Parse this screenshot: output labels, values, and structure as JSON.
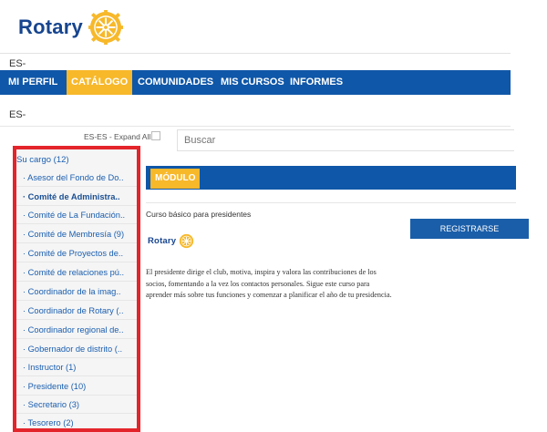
{
  "brand": {
    "name": "Rotary",
    "color": "#17458f",
    "wheel_color": "#f7b82a"
  },
  "lang_top": "ES-",
  "nav": {
    "items": [
      {
        "label": "MI PERFIL",
        "active": false
      },
      {
        "label": "CATÁLOGO",
        "active": true
      },
      {
        "label": "COMUNIDADES",
        "active": false
      },
      {
        "label": "MIS CURSOS",
        "active": false
      },
      {
        "label": "INFORMES",
        "active": false
      }
    ],
    "bg_color": "#0f57a8",
    "active_color": "#f7b82a"
  },
  "lang_second": "ES-",
  "expand": {
    "label": "ES-ES - Expand All",
    "checked": false
  },
  "search": {
    "placeholder": "Buscar",
    "value": ""
  },
  "sidebar": {
    "title": "Su cargo (12)",
    "items": [
      {
        "label": "· Asesor del Fondo de Do..",
        "bold": false
      },
      {
        "label": "· Comité de Administra..",
        "bold": true
      },
      {
        "label": "· Comité de La Fundación..",
        "bold": false
      },
      {
        "label": "· Comité de Membresía (9)",
        "bold": false
      },
      {
        "label": "· Comité de Proyectos de..",
        "bold": false
      },
      {
        "label": "· Comité de relaciones pú..",
        "bold": false
      },
      {
        "label": "· Coordinador de la imag..",
        "bold": false
      },
      {
        "label": "· Coordinador de Rotary (..",
        "bold": false
      },
      {
        "label": "· Coordinador regional de..",
        "bold": false
      },
      {
        "label": "· Gobernador de distrito (..",
        "bold": false
      },
      {
        "label": "· Instructor (1)",
        "bold": false
      },
      {
        "label": "· Presidente (10)",
        "bold": false
      },
      {
        "label": "· Secretario (3)",
        "bold": false
      },
      {
        "label": "· Tesorero (2)",
        "bold": false
      }
    ],
    "highlight_color": "#e4242b"
  },
  "module": {
    "label": "MÓDULO"
  },
  "course": {
    "title": "Curso básico para presidentes",
    "register_label": "REGISTRARSE",
    "logo_text": "Rotary",
    "description": "El presidente dirige el club, motiva, inspira y valora las contribuciones de los socios, fomentando a la vez los contactos personales. Sigue este curso para aprender más sobre tus funciones y comenzar a planificar el año de tu presidencia."
  }
}
